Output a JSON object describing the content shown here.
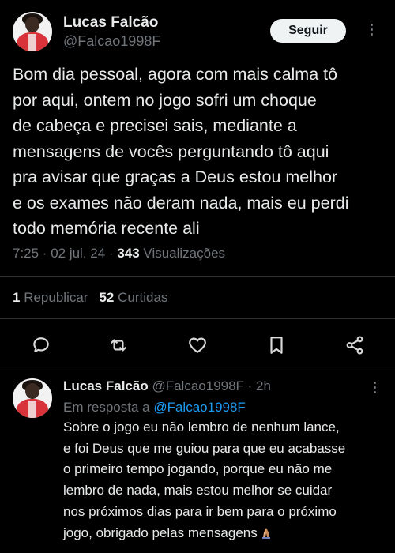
{
  "main_tweet": {
    "author": {
      "name": "Lucas Falcão",
      "handle": "@Falcao1998F"
    },
    "follow_label": "Seguir",
    "text": "Bom dia pessoal, agora com mais calma tô\npor aqui, ontem no jogo sofri um choque\nde cabeça e precisei sais, mediante a\nmensagens de vocês perguntando tô aqui\npra avisar que graças a Deus estou melhor\ne os exames não deram nada, mais eu perdi\ntodo memória recente ali",
    "time": "7:25 · 02 jul. 24 · ",
    "views_count": "343",
    "views_label": " Visualizações",
    "reposts_count": "1",
    "reposts_label": " Republicar",
    "likes_count": "52",
    "likes_label": " Curtidas"
  },
  "reply": {
    "author": {
      "name": "Lucas Falcão",
      "handle": "@Falcao1998F",
      "time_ago": " · 2h"
    },
    "replying_prefix": "Em resposta a ",
    "replying_to": "@Falcao1998F",
    "text": "Sobre o jogo eu não lembro de nenhum lance,\ne foi Deus que me guiou para que eu acabasse\no primeiro tempo jogando, porque eu não me\nlembro de nada, mais estou melhor se cuidar\nnos próximos dias para ir bem para o próximo\njogo, obrigado pelas mensagens"
  },
  "icons": [
    "reply-icon",
    "repost-icon",
    "like-icon",
    "bookmark-icon",
    "share-icon",
    "more-icon",
    "folded-hands-emoji"
  ],
  "colors": {
    "background": "#000000",
    "text": "#e7e9ea",
    "muted": "#71767b",
    "link": "#1d9bf0",
    "button_bg": "#eff3f4"
  }
}
